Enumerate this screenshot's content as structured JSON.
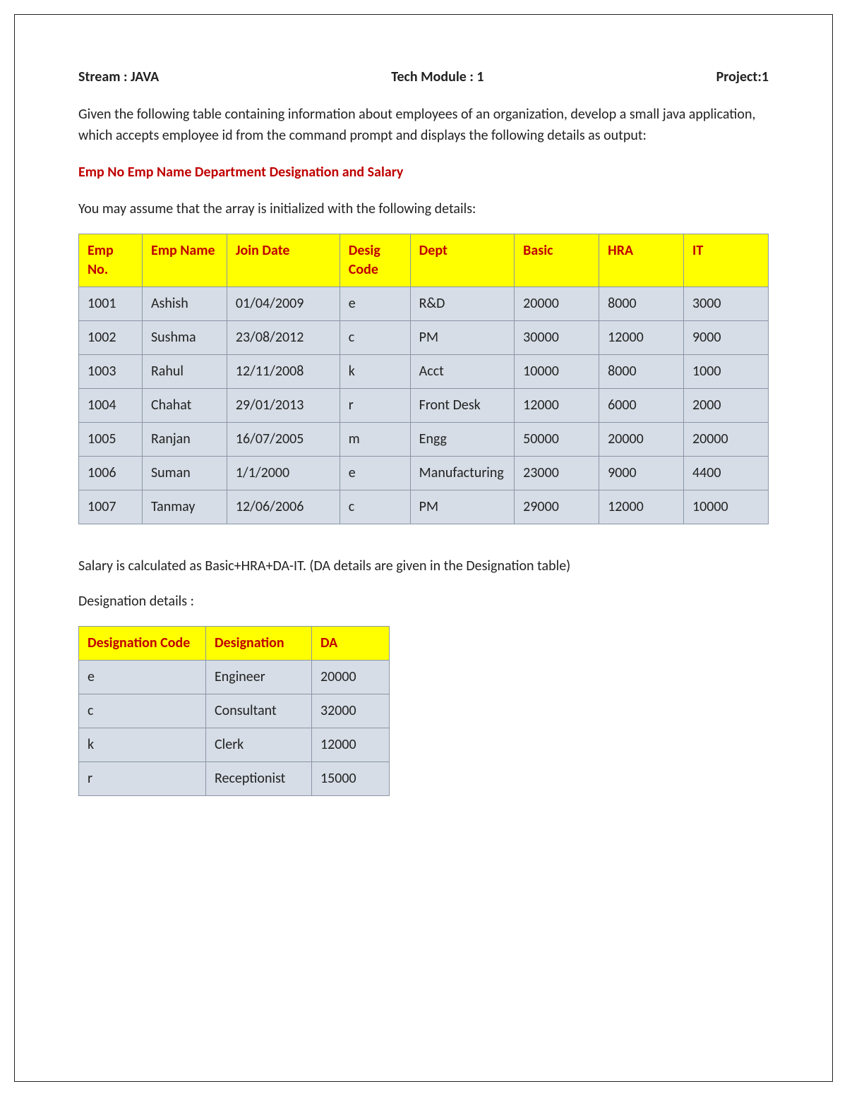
{
  "header": {
    "stream": "Stream : JAVA",
    "module": "Tech Module : 1",
    "project": "Project:1"
  },
  "intro": "Given the following table containing information about employees of an organization, develop a small java application, which accepts employee id from the command prompt and displays the following details as output:",
  "output_fields_line": "Emp No  Emp Name  Department Designation and Salary",
  "assume_line": "You may assume that the array is initialized with the following details:",
  "emp_table": {
    "headers": [
      "Emp No.",
      "Emp Name",
      "Join Date",
      "Desig Code",
      "Dept",
      "Basic",
      "HRA",
      "IT"
    ],
    "rows": [
      [
        "1001",
        "Ashish",
        "01/04/2009",
        "e",
        "R&D",
        "20000",
        "8000",
        "3000"
      ],
      [
        "1002",
        "Sushma",
        "23/08/2012",
        "c",
        "PM",
        "30000",
        "12000",
        "9000"
      ],
      [
        "1003",
        "Rahul",
        "12/11/2008",
        "k",
        "Acct",
        "10000",
        "8000",
        "1000"
      ],
      [
        "1004",
        "Chahat",
        "29/01/2013",
        "r",
        "Front Desk",
        "12000",
        "6000",
        "2000"
      ],
      [
        "1005",
        "Ranjan",
        "16/07/2005",
        "m",
        "Engg",
        "50000",
        "20000",
        "20000"
      ],
      [
        "1006",
        "Suman",
        "1/1/2000",
        "e",
        "Manufacturing",
        "23000",
        "9000",
        "4400"
      ],
      [
        "1007",
        "Tanmay",
        "12/06/2006",
        "c",
        "PM",
        "29000",
        "12000",
        "10000"
      ]
    ]
  },
  "salary_note": "Salary is calculated as Basic+HRA+DA-IT. (DA details are given in the Designation table)",
  "desig_label": "Designation details :",
  "desig_table": {
    "headers": [
      "Designation Code",
      "Designation",
      "DA"
    ],
    "rows": [
      [
        "e",
        "Engineer",
        "20000"
      ],
      [
        "c",
        "Consultant",
        "32000"
      ],
      [
        "k",
        "Clerk",
        "12000"
      ],
      [
        "r",
        "Receptionist",
        "15000"
      ]
    ]
  }
}
